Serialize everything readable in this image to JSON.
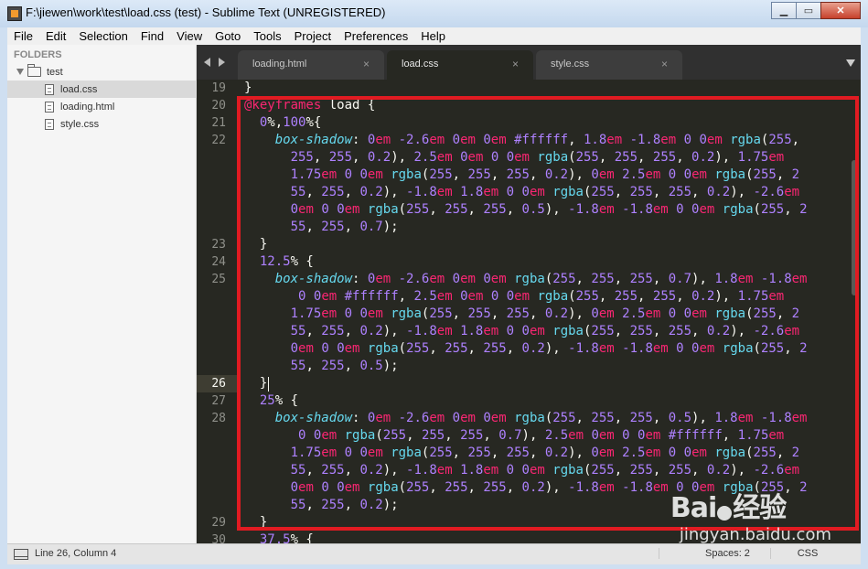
{
  "window": {
    "title": "F:\\jiewen\\work\\test\\load.css (test) - Sublime Text (UNREGISTERED)"
  },
  "menu": [
    "File",
    "Edit",
    "Selection",
    "Find",
    "View",
    "Goto",
    "Tools",
    "Project",
    "Preferences",
    "Help"
  ],
  "sidebar": {
    "header": "FOLDERS",
    "folder": "test",
    "files": [
      "load.css",
      "loading.html",
      "style.css"
    ],
    "selected_file": "load.css"
  },
  "tabs": [
    {
      "label": "loading.html",
      "close": "×",
      "active": false
    },
    {
      "label": "load.css",
      "close": "×",
      "active": true
    },
    {
      "label": "style.css",
      "close": "×",
      "active": false
    }
  ],
  "editor": {
    "current_line": 26,
    "line_numbers": [
      "19",
      "20",
      "21",
      "22",
      "23",
      "24",
      "25",
      "26",
      "27",
      "28",
      "29",
      "30"
    ]
  },
  "status": {
    "position": "Line 26, Column 4",
    "indent": "Spaces: 2",
    "syntax": "CSS"
  },
  "watermark": {
    "brand": "Bai",
    "brand2": "经验",
    "url": "jingyan.baidu.com"
  },
  "colors": {
    "keyword": "#f92672",
    "property": "#66d9ef",
    "number": "#ae81ff",
    "background": "#272822",
    "highlight_box": "#e11b22"
  }
}
